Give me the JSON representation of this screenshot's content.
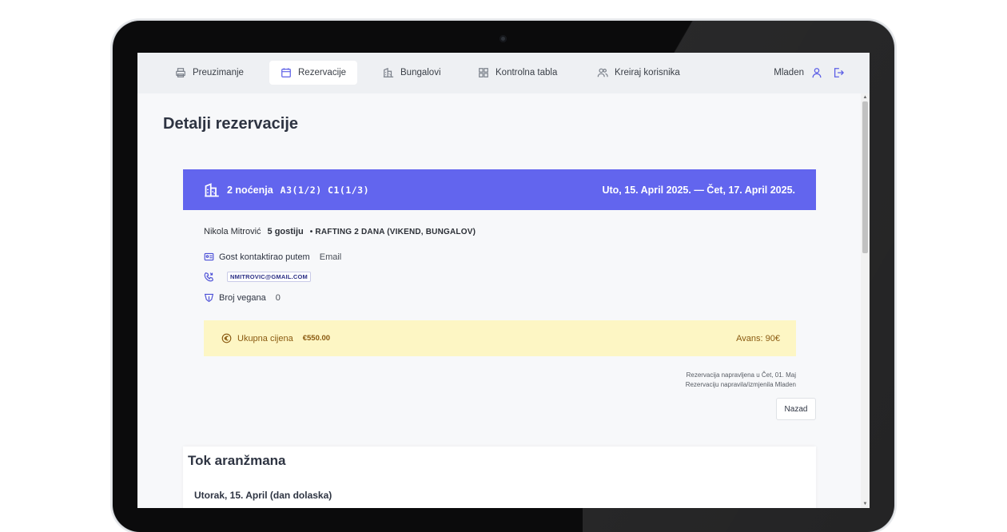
{
  "nav": {
    "items": [
      {
        "label": "Preuzimanje",
        "icon": "printer-icon"
      },
      {
        "label": "Rezervacije",
        "icon": "calendar-icon",
        "active": true
      },
      {
        "label": "Bungalovi",
        "icon": "bungalow-icon"
      },
      {
        "label": "Kontrolna tabla",
        "icon": "dashboard-icon"
      },
      {
        "label": "Kreiraj korisnika",
        "icon": "users-icon"
      }
    ],
    "user_name": "Mladen"
  },
  "page_title": "Detalji rezervacije",
  "reservation": {
    "nights": "2 noćenja",
    "units": "A3(1/2) C1(1/3)",
    "date_range": "Uto, 15. April 2025. — Čet, 17. April 2025.",
    "guest_name": "Nikola Mitrović",
    "guests": "5 gostiju",
    "package": "• RAFTING 2 DANA (VIKEND, BUNGALOV)",
    "contact_label": "Gost kontaktirao putem",
    "contact_value": "Email",
    "email": "NMITROVIC@GMAIL.COM",
    "vegan_label": "Broj vegana",
    "vegan_value": "0"
  },
  "price": {
    "label": "Ukupna cijena",
    "amount": "€550.00",
    "deposit": "Avans: 90€"
  },
  "meta": {
    "created": "Rezervacija napravljena u Čet, 01. Maj",
    "created_by": "Rezervaciju napravila/izmjenila Mladen"
  },
  "back_button": "Nazad",
  "timeline": {
    "title": "Tok aranžmana",
    "first_day": "Utorak, 15. April (dan dolaska)"
  },
  "colors": {
    "accent": "#6265ee",
    "price_bg": "#fdf6c4",
    "price_text": "#8a5a10"
  }
}
